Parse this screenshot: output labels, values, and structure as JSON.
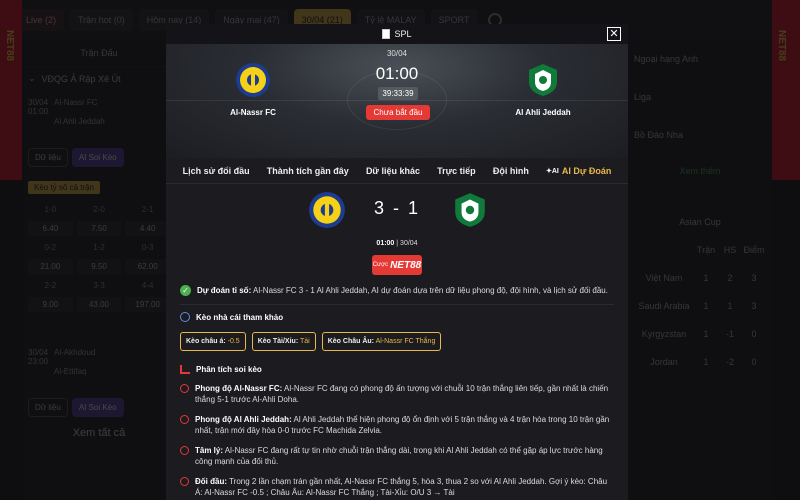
{
  "background": {
    "top_nav": [
      {
        "label": "Live (2)"
      },
      {
        "label": "Trận hot (0)"
      },
      {
        "label": "Hôm nay (14)"
      },
      {
        "label": "Ngày mai (47)"
      },
      {
        "label": "30/04 (21)"
      },
      {
        "label": "Tỷ lệ MALAY"
      },
      {
        "label": "SPORT"
      }
    ],
    "left": {
      "title": "Trận Đấu",
      "league": "VĐQG Ả Rập Xê Út",
      "match1": {
        "date": "30/04",
        "time": "01:00",
        "home": "Al-Nassr FC",
        "away": "Al Ahli Jeddah"
      },
      "data_btn": "Dữ liệu",
      "ai_btn": "AI Soi Kèo",
      "odds_tag": "Kèo tỷ số cả trận",
      "odds": [
        "1-0",
        "2-0",
        "2-1",
        "6.40",
        "7.50",
        "4.40",
        "0-2",
        "1-2",
        "0-3",
        "21.00",
        "9.50",
        "62.00",
        "2-2",
        "3-3",
        "4-4",
        "9.00",
        "43.00",
        "197.00"
      ],
      "match2": {
        "date": "30/04",
        "time": "23:00",
        "home": "Al-Akhdoud",
        "away": "Al-Ettifaq"
      },
      "see_all": "Xem tất cả"
    },
    "right": {
      "items": [
        "Ngoại hạng Anh",
        "Liga",
        "Bồ Đào Nha"
      ],
      "more": "Xem thêm",
      "cup": "Asian Cup",
      "header": [
        "Trận",
        "HS",
        "Điểm"
      ],
      "rows": [
        {
          "team": "Việt Nam",
          "m": "1",
          "hs": "2",
          "pts": "3"
        },
        {
          "team": "Saudi Arabia",
          "m": "1",
          "hs": "1",
          "pts": "3"
        },
        {
          "team": "Kyrgyzstan",
          "m": "1",
          "hs": "-1",
          "pts": "0"
        },
        {
          "team": "Jordan",
          "m": "1",
          "hs": "-2",
          "pts": "0"
        }
      ]
    }
  },
  "modal": {
    "league": "SPL",
    "date": "30/04",
    "time": "01:00",
    "countdown": "39:33:39",
    "status": "Chưa bắt đầu",
    "home": "Al-Nassr FC",
    "away": "Al Ahli Jeddah",
    "tabs": [
      "Lịch sử đối đầu",
      "Thành tích gần đây",
      "Dữ liệu khác",
      "Trực tiếp",
      "Đội hình",
      "AI Dự Đoán"
    ],
    "score": "3 - 1",
    "kickoff_time": "01:00",
    "kickoff_date": "30/04",
    "bet_prefix": "Cược",
    "bet_brand": "NET88",
    "prediction_label": "Dự đoán tỉ số:",
    "prediction_text": "Al-Nassr FC 3 - 1 Al Ahli Jeddah, AI dự đoán dựa trên dữ liệu phong độ, đội hình, và lịch sử đối đầu.",
    "ref_title": "Kèo nhà cái tham khảo",
    "chips": [
      {
        "label": "Kèo châu á:",
        "value": "-0.5"
      },
      {
        "label": "Kèo Tài/Xỉu:",
        "value": "Tài"
      },
      {
        "label": "Kèo Châu Âu:",
        "value": "Al-Nassr FC Thắng"
      }
    ],
    "analysis_title": "Phân tích soi kèo",
    "analysis": [
      {
        "label": "Phong độ Al-Nassr FC:",
        "text": "Al-Nassr FC đang có phong độ ấn tượng với chuỗi 10 trận thắng liên tiếp, gần nhất là chiến thắng 5-1 trước Al-Ahli Doha."
      },
      {
        "label": "Phong độ Al Ahli Jeddah:",
        "text": "Al Ahli Jeddah thể hiện phong độ ổn định với 5 trận thắng và 4 trận hòa trong 10 trận gần nhất, trận mới đây hòa 0-0 trước FC Machida Zelvia."
      },
      {
        "label": "Tâm lý:",
        "text": "Al-Nassr FC đang rất tự tin nhờ chuỗi trận thắng dài, trong khi Al Ahli Jeddah có thể gặp áp lực trước hàng công mạnh của đối thủ."
      },
      {
        "label": "Đối đầu:",
        "text": "Trong 2 lần chạm trán gần nhất, Al-Nassr FC thắng 5, hòa 3, thua 2 so với Al Ahli Jeddah. Gợi ý kèo: Châu Á: Al-Nassr FC -0.5 ; Châu Âu: Al-Nassr FC Thắng ; Tài-Xỉu: O/U 3 → Tài"
      }
    ]
  },
  "colors": {
    "accent": "#e9b84a",
    "danger": "#e53935",
    "success": "#4caf50",
    "ai_purple": "#5e3ea8"
  }
}
